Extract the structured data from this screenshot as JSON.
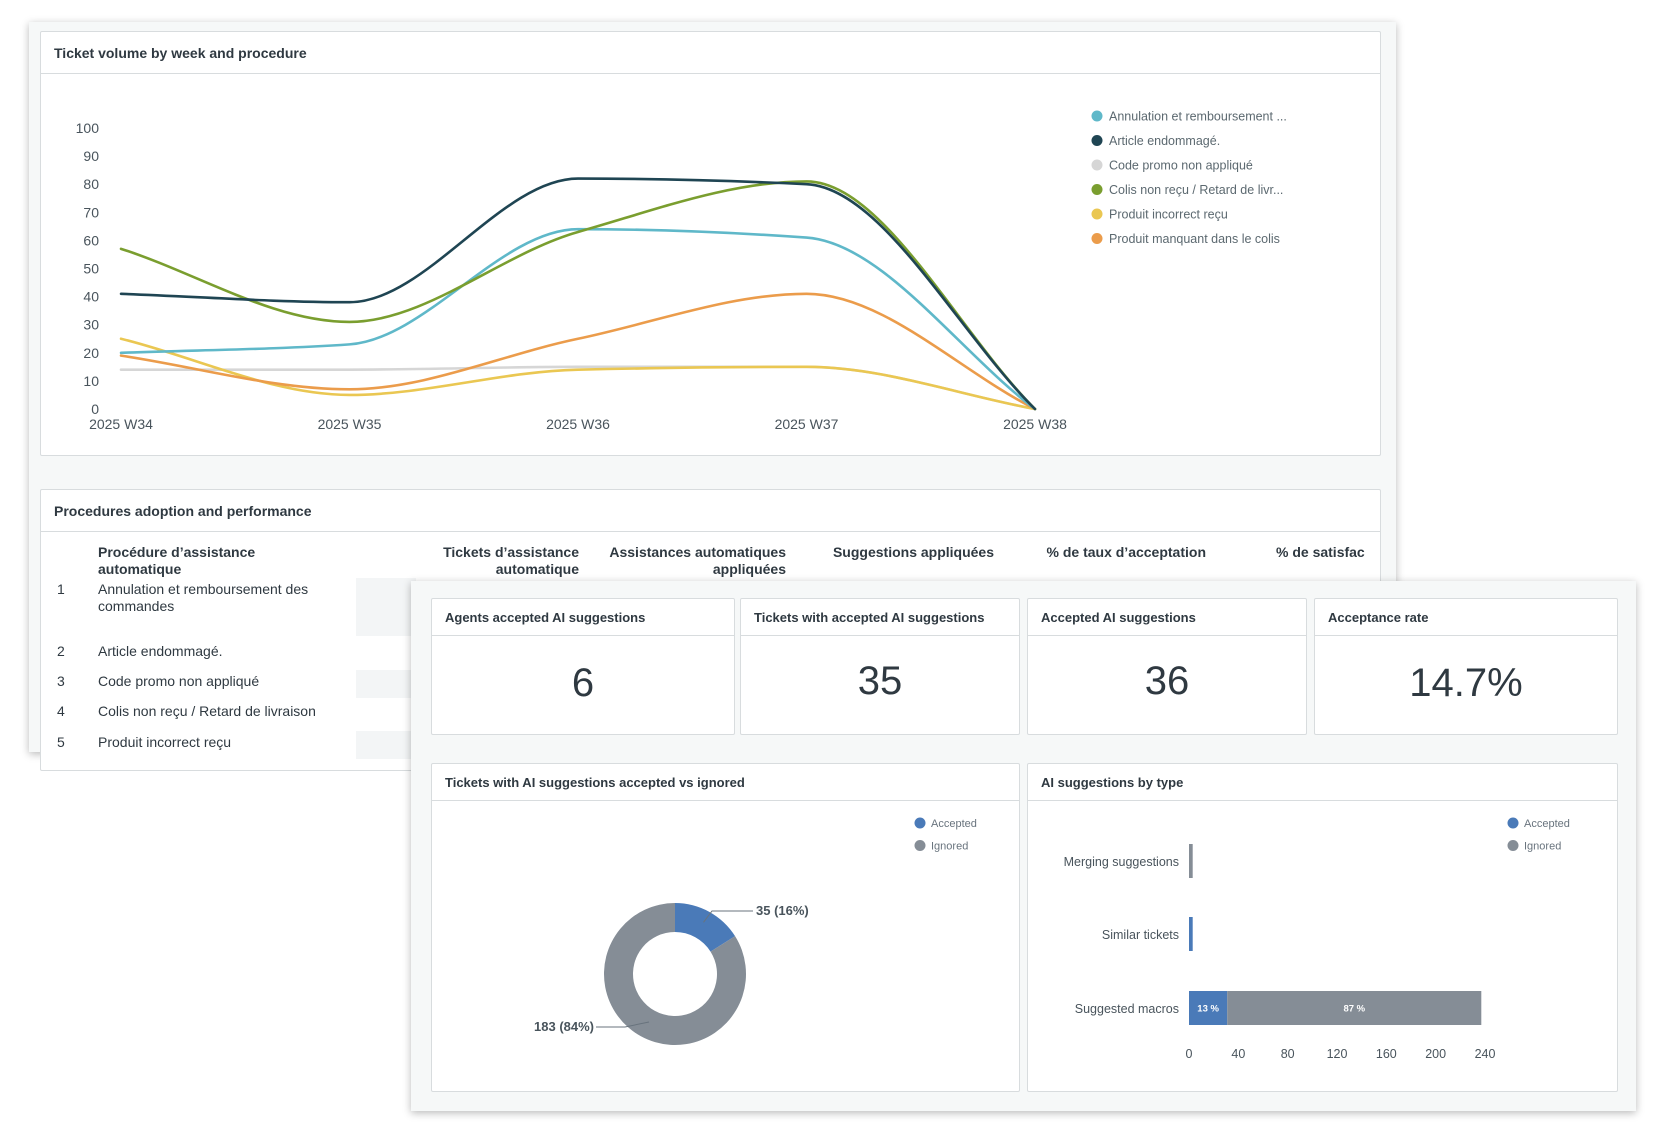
{
  "colors": {
    "annulation": "#5fb8c9",
    "article": "#1f4553",
    "code_promo": "#d6d6d6",
    "colis": "#7a9e2f",
    "produit_incorrect": "#eac752",
    "produit_manquant": "#eb9c4b",
    "accepted": "#4a7ab8",
    "ignored": "#858d96"
  },
  "line_card": {
    "title": "Ticket volume by week and procedure"
  },
  "table_card": {
    "title": "Procedures adoption and performance",
    "headers": {
      "procedure": [
        "Procédure d’assistance",
        "automatique"
      ],
      "tickets": [
        "Tickets d’assistance",
        "automatique"
      ],
      "assistances": [
        "Assistances automatiques",
        "appliquées"
      ],
      "suggestions": "Suggestions appliquées",
      "acceptance": "% de taux d’acceptation",
      "satisfaction": "% de satisfac"
    },
    "rows": [
      {
        "index": "1",
        "name": [
          "Annulation et remboursement des",
          "commandes"
        ]
      },
      {
        "index": "2",
        "name": [
          "Article endommagé."
        ]
      },
      {
        "index": "3",
        "name": [
          "Code promo non appliqué"
        ]
      },
      {
        "index": "4",
        "name": [
          "Colis non reçu / Retard de livraison"
        ]
      },
      {
        "index": "5",
        "name": [
          "Produit incorrect reçu"
        ]
      }
    ]
  },
  "kpis": [
    {
      "title": "Agents accepted AI suggestions",
      "value": "6"
    },
    {
      "title": "Tickets with accepted AI suggestions",
      "value": "35"
    },
    {
      "title": "Accepted AI suggestions",
      "value": "36"
    },
    {
      "title": "Acceptance rate",
      "value": "14.7%"
    }
  ],
  "donut_card": {
    "title": "Tickets with AI suggestions accepted vs ignored"
  },
  "bar_card": {
    "title": "AI suggestions by type"
  },
  "chart_data": [
    {
      "type": "line",
      "title": "Ticket volume by week and procedure",
      "x": [
        "2025 W34",
        "2025 W35",
        "2025 W36",
        "2025 W37",
        "2025 W38"
      ],
      "ylim": [
        0,
        100
      ],
      "yticks": [
        0,
        10,
        20,
        30,
        40,
        50,
        60,
        70,
        80,
        90,
        100
      ],
      "legend_position": "top-right",
      "series": [
        {
          "name": "Annulation et remboursement ...",
          "color_key": "annulation",
          "values": [
            20,
            23,
            64,
            61,
            0
          ]
        },
        {
          "name": "Article endommagé.",
          "color_key": "article",
          "values": [
            41,
            38,
            82,
            80,
            0
          ]
        },
        {
          "name": "Code promo non appliqué",
          "color_key": "code_promo",
          "values": [
            14,
            14,
            15,
            15,
            0
          ]
        },
        {
          "name": "Colis non reçu / Retard de livr...",
          "color_key": "colis",
          "values": [
            57,
            31,
            63,
            81,
            0
          ]
        },
        {
          "name": "Produit incorrect reçu",
          "color_key": "produit_incorrect",
          "values": [
            25,
            5,
            14,
            15,
            0
          ]
        },
        {
          "name": "Produit manquant dans le colis",
          "color_key": "produit_manquant",
          "values": [
            19,
            7,
            25,
            41,
            0
          ]
        }
      ]
    },
    {
      "type": "pie",
      "title": "Tickets with AI suggestions accepted vs ignored",
      "legend_position": "top-right",
      "slices": [
        {
          "name": "Accepted",
          "value": 35,
          "label": "35 (16%)",
          "color_key": "accepted"
        },
        {
          "name": "Ignored",
          "value": 183,
          "label": "183 (84%)",
          "color_key": "ignored"
        }
      ]
    },
    {
      "type": "bar",
      "orientation": "horizontal",
      "stacked": true,
      "title": "AI suggestions by type",
      "legend_position": "top-right",
      "categories": [
        "Merging suggestions",
        "Similar tickets",
        "Suggested macros"
      ],
      "xlim": [
        0,
        240
      ],
      "xticks": [
        0,
        40,
        80,
        120,
        160,
        200,
        240
      ],
      "series": [
        {
          "name": "Accepted",
          "color_key": "accepted",
          "values": [
            0,
            3,
            31
          ],
          "labels": [
            "",
            "",
            "13 %"
          ]
        },
        {
          "name": "Ignored",
          "color_key": "ignored",
          "values": [
            3,
            0,
            206
          ],
          "labels": [
            "",
            "",
            "87 %"
          ]
        }
      ]
    }
  ]
}
